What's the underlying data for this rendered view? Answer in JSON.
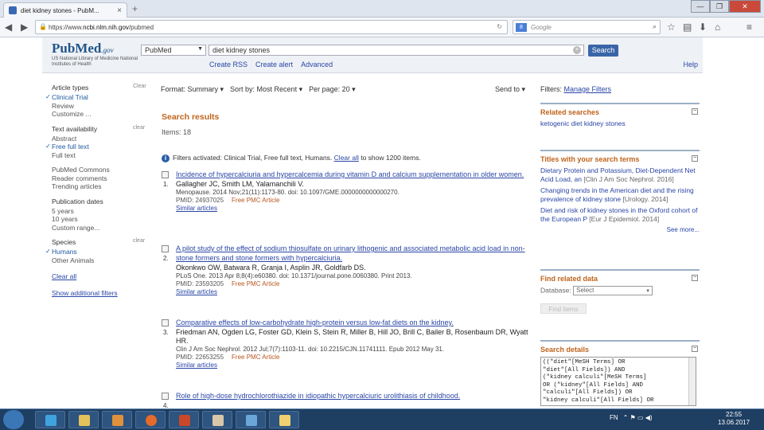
{
  "browser": {
    "tab_title": "diet kidney stones - PubM...",
    "new_tab": "+",
    "url_prefix": "https://www.",
    "url_host": "ncbi.nlm.nih.gov",
    "url_path": "/pubmed",
    "search_engine_placeholder": "Google",
    "win_min": "—",
    "win_max": "❐",
    "win_close": "✕"
  },
  "header": {
    "logo_text": "PubMed",
    "logo_suffix": ".gov",
    "logo_sub": "US National Library of Medicine National Institutes of Health",
    "database": "PubMed",
    "query": "diet kidney stones",
    "search_label": "Search",
    "links": [
      "Create RSS",
      "Create alert",
      "Advanced"
    ],
    "help": "Help"
  },
  "filters": {
    "groups": [
      {
        "title": "Article types",
        "clear": "Clear",
        "items": [
          {
            "label": "Clinical Trial",
            "on": true
          },
          {
            "label": "Review",
            "on": false
          },
          {
            "label": "Customize ...",
            "on": false
          }
        ]
      },
      {
        "title": "Text availability",
        "clear": "clear",
        "items": [
          {
            "label": "Abstract",
            "on": false
          },
          {
            "label": "Free full text",
            "on": true
          },
          {
            "label": "Full text",
            "on": false
          }
        ]
      },
      {
        "title": "",
        "clear": "",
        "items": [
          {
            "label": "PubMed Commons",
            "on": false
          },
          {
            "label": "Reader comments",
            "on": false
          },
          {
            "label": "Trending articles",
            "on": false
          }
        ]
      },
      {
        "title": "Publication dates",
        "clear": "",
        "items": [
          {
            "label": "5 years",
            "on": false
          },
          {
            "label": "10 years",
            "on": false
          },
          {
            "label": "Custom range...",
            "on": false
          }
        ]
      },
      {
        "title": "Species",
        "clear": "clear",
        "items": [
          {
            "label": "Humans",
            "on": true
          },
          {
            "label": "Other Animals",
            "on": false
          }
        ]
      }
    ],
    "clear_all": "Clear all",
    "show_additional": "Show additional filters"
  },
  "toolbar": {
    "format": "Format: Summary ▾",
    "sort": "Sort by: Most Recent ▾",
    "per_page": "Per page: 20 ▾",
    "send_to": "Send to ▾"
  },
  "results": {
    "heading": "Search results",
    "count": "Items: 18",
    "filters_note_prefix": "Filters activated: Clinical Trial, Free full text, Humans.",
    "filters_clear": "Clear all",
    "filters_note_suffix": "to show 1200 items.",
    "items": [
      {
        "num": "1.",
        "title": "Incidence of hypercalciuria and hypercalcemia during vitamin D and calcium supplementation in older women.",
        "authors": "Gallagher JC, Smith LM, Yalamanchili V.",
        "cite": "Menopause. 2014 Nov;21(11):1173-80. doi: 10.1097/GME.0000000000000270.",
        "pmid": "PMID: 24937025",
        "free": "Free PMC Article",
        "similar": "Similar articles"
      },
      {
        "num": "2.",
        "title": "A pilot study of the effect of sodium thiosulfate on urinary lithogenic and associated metabolic acid load in non-stone formers and stone formers with hypercalciuria.",
        "authors": "Okonkwo OW, Batwara R, Granja I, Asplin JR, Goldfarb DS.",
        "cite": "PLoS One. 2013 Apr 8;8(4):e60380. doi: 10.1371/journal.pone.0060380. Print 2013.",
        "pmid": "PMID: 23593205",
        "free": "Free PMC Article",
        "similar": "Similar articles"
      },
      {
        "num": "3.",
        "title": "Comparative effects of low-carbohydrate high-protein versus low-fat diets on the kidney.",
        "authors": "Friedman AN, Ogden LG, Foster GD, Klein S, Stein R, Miller B, Hill JO, Brill C, Bailer B, Rosenbaum DR, Wyatt HR.",
        "cite": "Clin J Am Soc Nephrol. 2012 Jul;7(7):1103-11. doi: 10.2215/CJN.11741111. Epub 2012 May 31.",
        "pmid": "PMID: 22653255",
        "free": "Free PMC Article",
        "similar": "Similar articles"
      },
      {
        "num": "4.",
        "title": "Role of high-dose hydrochlorothiazide in idiopathic hypercalciuric urolithiasis of childhood.",
        "authors": "",
        "cite": "",
        "pmid": "",
        "free": "",
        "similar": ""
      }
    ]
  },
  "sidebar": {
    "filters_label": "Filters:",
    "manage_filters": "Manage Filters",
    "related_title": "Related searches",
    "related_items": [
      "ketogenic diet kidney stones"
    ],
    "titles_title": "Titles with your search terms",
    "titles_items": [
      {
        "text": "Dietary Protein and Potassium, Diet-Dependent Net Acid Load, an",
        "src": "[Clin J Am Soc Nephrol. 2016]"
      },
      {
        "text": "Changing trends in the American diet and the rising prevalence of kidney stone",
        "src": "[Urology. 2014]"
      },
      {
        "text": "Diet and risk of kidney stones in the Oxford cohort of the European P",
        "src": "[Eur J Epidemiol. 2014]"
      }
    ],
    "see_more": "See more...",
    "related_data_title": "Find related data",
    "database_label": "Database:",
    "database_value": "Select",
    "find_items": "Find items",
    "details_title": "Search details",
    "details_text": "((\"diet\"[MeSH Terms] OR\n\"diet\"[All Fields]) AND\n(\"kidney calculi\"[MeSH Terms]\nOR (\"kidney\"[All Fields] AND\n\"calculi\"[All Fields]) OR\n\"kidney calculi\"[All Fields] OR"
  },
  "taskbar": {
    "lang": "FN",
    "tray_icons": "⌃ ⚑ ▭ ◀)",
    "time": "22:55",
    "date": "13.06.2017"
  },
  "colors": {
    "accent": "#c0631b",
    "link": "#2a46a6",
    "taskbar": "#1e3e62",
    "search_button": "#3a65a8"
  }
}
